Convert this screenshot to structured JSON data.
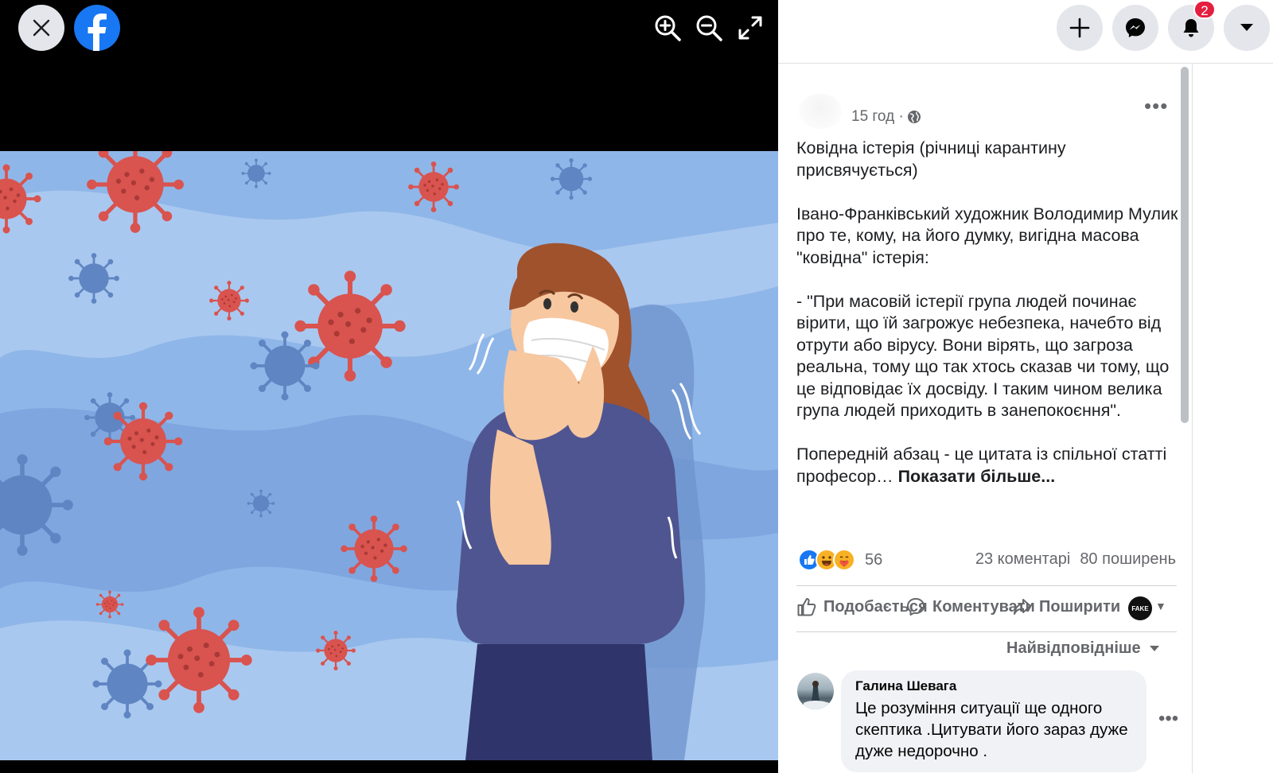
{
  "viewer": {
    "close_icon": "close-icon",
    "logo_icon": "facebook-logo-icon",
    "tools": [
      "zoom-in-icon",
      "zoom-out-icon",
      "fullscreen-icon"
    ],
    "photo_alt": "Ілюстрація: жінка в масці серед вірусів"
  },
  "topbar": {
    "buttons": [
      "plus-icon",
      "messenger-icon",
      "bell-icon",
      "caret-down-icon"
    ],
    "notification_count": "2"
  },
  "post": {
    "time": "15 год ·",
    "paragraphs": [
      "Ковідна істерія (річниці карантину присвячується)",
      "Івано-Франківський художник Володимир Мулик про те, кому, на його думку, вигідна масова \"ковідна\" істерія:",
      "- \"При масовій істерії група людей починає вірити, що їй загрожує небезпека, начебто від отрути або вірусу. Вони вірять, що загроза реальна, тому що так хтось сказав чи тому, що це відповідає їх досвіду. І таким чином велика група людей приходить в занепокоєння\".",
      "Попередній абзац - це цитата із спільної статті професор…"
    ],
    "see_more": "Показати більше..."
  },
  "stats": {
    "reaction_count": "56",
    "comments": "23 коментарі",
    "shares": "80 поширень"
  },
  "actions": {
    "like": "Подобається",
    "comment": "Коментувати",
    "share": "Поширити",
    "page_badge": "FAKE"
  },
  "comments": {
    "sort_label": "Найвідповідніше",
    "items": [
      {
        "author": "Галина Шевага",
        "text": "Це розуміння ситуації ще одного скептика .Цитувати його зараз дуже дуже недорочно ."
      }
    ]
  },
  "colors": {
    "fb_blue": "#1877f2",
    "photo_bg": "#8fb6e8",
    "virus_red": "#d9534f",
    "badge_red": "#e41e3f"
  }
}
